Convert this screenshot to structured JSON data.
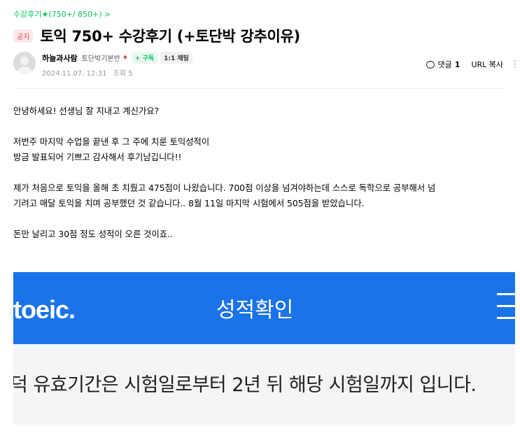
{
  "breadcrumb": "수강후기★(750+/ 850+) >",
  "post": {
    "badge": "공지",
    "title": "토익 750+ 수강후기 (+토단박 강추이유)"
  },
  "author": {
    "name": "하늘과사람",
    "level": "토단박기본반",
    "level_icon": "carrot-icon",
    "subscribe_label": "+ 구독",
    "chat_label": "1:1 채팅",
    "date": "2024.11.07. 12:31",
    "views_label": "조회 5"
  },
  "actions": {
    "comment_label": "댓글",
    "comment_count": "1",
    "url_copy_label": "URL 복사",
    "more_icon": "more-vertical-icon"
  },
  "body": {
    "paragraphs": [
      "안녕하세요! 선생님 잘 지내고 계신가요?",
      "저번주 마지막 수업을 끝낸 후 그 주에 치룬 토익성적이\n방금 발표되어 기쁘고 감사해서 후기남깁니다!!",
      "제가 처음으로 토익을 올해 초 치뤘고 475점이 나왔습니다. 700점 이상을 넘겨야하는데 스스로 독학으로 공부해서 넘\n기려고 매달 토익을 치며 공부했던 것 같습니다.. 8월 11일 마지막 시험에서 505점을 받았습니다.",
      "돈만 날리고 30점 정도 성적이 오른 것이죠.."
    ]
  },
  "embedded_image": {
    "logo_text": "toeic.",
    "heading": "성적확인",
    "notice": "덕 유효기간은 시험일로부터 2년 뒤 해당 시험일까지 입니다.",
    "header_color": "#1a73e8",
    "band_color": "#f4f5f7"
  },
  "colors": {
    "accent_green": "#03c75a",
    "badge_red": "#e6434b"
  }
}
